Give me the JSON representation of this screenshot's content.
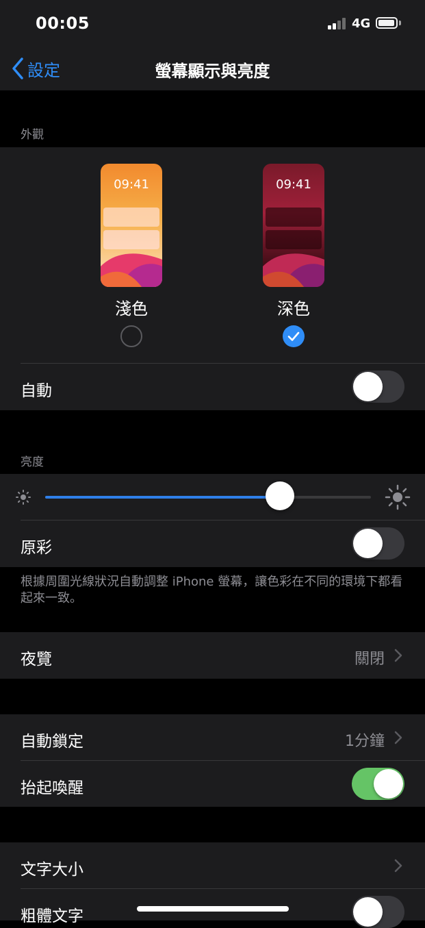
{
  "status_bar": {
    "time": "00:05",
    "network": "4G",
    "signal_bars_filled": 2,
    "signal_bars_total": 4
  },
  "nav": {
    "back_label": "設定",
    "title": "螢幕顯示與亮度"
  },
  "appearance": {
    "header": "外觀",
    "light": {
      "preview_time": "09:41",
      "label": "淺色",
      "selected": false
    },
    "dark": {
      "preview_time": "09:41",
      "label": "深色",
      "selected": true
    },
    "automatic": {
      "label": "自動",
      "on": false
    }
  },
  "brightness": {
    "header": "亮度",
    "level": 0.72,
    "true_tone": {
      "label": "原彩",
      "on": false
    },
    "footer": "根據周圍光線狀況自動調整 iPhone 螢幕，讓色彩在不同的環境下都看起來一致。"
  },
  "night_shift": {
    "label": "夜覽",
    "value": "關閉"
  },
  "auto_lock": {
    "label": "自動鎖定",
    "value": "1分鐘"
  },
  "raise_to_wake": {
    "label": "抬起喚醒",
    "on": true
  },
  "text_size": {
    "label": "文字大小"
  },
  "bold_text": {
    "label": "粗體文字",
    "on": false
  },
  "colors": {
    "accent": "#2f8df7",
    "toggle_on": "#65c466",
    "background": "#000000",
    "cell": "#1c1c1e"
  }
}
